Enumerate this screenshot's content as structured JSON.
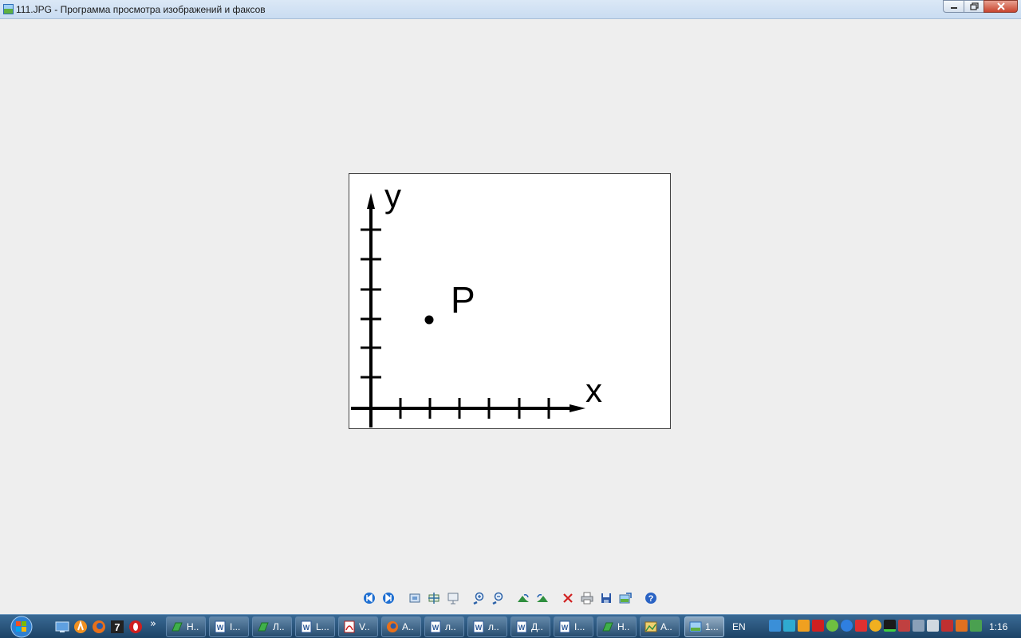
{
  "window": {
    "title": "111.JPG - Программа просмотра изображений и факсов"
  },
  "image": {
    "y_label": "y",
    "x_label": "x",
    "point_label": "P"
  },
  "toolbar": {
    "icons": [
      "previous-icon",
      "next-icon",
      "best-fit-icon",
      "actual-size-icon",
      "slideshow-icon",
      "zoom-in-icon",
      "zoom-out-icon",
      "rotate-clockwise-icon",
      "rotate-counterclockwise-icon",
      "delete-icon",
      "print-icon",
      "save-icon",
      "open-with-icon",
      "help-icon"
    ]
  },
  "taskbar": {
    "tasks": [
      {
        "label": "Н..",
        "icon": "green-app-icon"
      },
      {
        "label": "I...",
        "icon": "word-doc-icon"
      },
      {
        "label": "Л..",
        "icon": "green-app-icon"
      },
      {
        "label": "L...",
        "icon": "word-doc-icon"
      },
      {
        "label": "V..",
        "icon": "pdf-icon"
      },
      {
        "label": "A..",
        "icon": "firefox-icon"
      },
      {
        "label": "л..",
        "icon": "word-doc-icon"
      },
      {
        "label": "л..",
        "icon": "word-doc-icon"
      },
      {
        "label": "Д..",
        "icon": "word-doc-icon"
      },
      {
        "label": "I...",
        "icon": "word-doc-icon"
      },
      {
        "label": "Н..",
        "icon": "green-app-icon"
      },
      {
        "label": "А..",
        "icon": "image-app-icon"
      },
      {
        "label": "1...",
        "icon": "image-viewer-icon"
      }
    ],
    "language": "EN",
    "clock": "1:16"
  }
}
